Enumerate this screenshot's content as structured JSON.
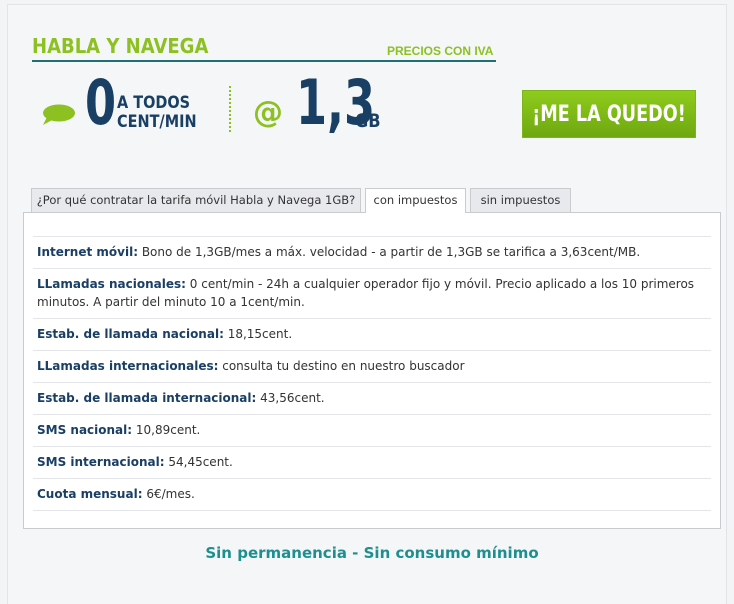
{
  "header": {
    "title": "HABLA Y NAVEGA",
    "price_note": "PRECIOS CON IVA"
  },
  "offer": {
    "calls_value": "0",
    "calls_unit_line1": "A TODOS",
    "calls_unit_line2": "CENT/MIN",
    "data_prefix": "@",
    "data_value": "1,3",
    "data_unit": "GB"
  },
  "cta": {
    "label": "¡ME LA QUEDO!"
  },
  "tabs": [
    {
      "label": "¿Por qué contratar la tarifa móvil Habla y Navega 1GB?",
      "active": false
    },
    {
      "label": "con impuestos",
      "active": true
    },
    {
      "label": "sin impuestos",
      "active": false
    }
  ],
  "rows": [
    {
      "label": "Internet móvil:",
      "value": "Bono de 1,3GB/mes a máx. velocidad - a partir de 1,3GB se tarifica a 3,63cent/MB."
    },
    {
      "label": "LLamadas nacionales:",
      "value": "0 cent/min - 24h a cualquier operador fijo y móvil. Precio aplicado a los 10 primeros minutos. A partir del minuto 10 a 1cent/min."
    },
    {
      "label": "Estab. de llamada nacional:",
      "value": "18,15cent."
    },
    {
      "label": "LLamadas internacionales:",
      "value": "consulta tu destino en nuestro buscador"
    },
    {
      "label": "Estab. de llamada internacional:",
      "value": "43,56cent."
    },
    {
      "label": "SMS nacional:",
      "value": "10,89cent."
    },
    {
      "label": "SMS internacional:",
      "value": "54,45cent."
    },
    {
      "label": "Cuota mensual:",
      "value": "6€/mes."
    }
  ],
  "footer": {
    "note": "Sin permanencia - Sin consumo mínimo"
  },
  "colors": {
    "green": "#8cc121",
    "navy": "#1a3f64",
    "teal": "#1f8e90"
  },
  "icons": {
    "calls": "speech-bubble-icon"
  }
}
